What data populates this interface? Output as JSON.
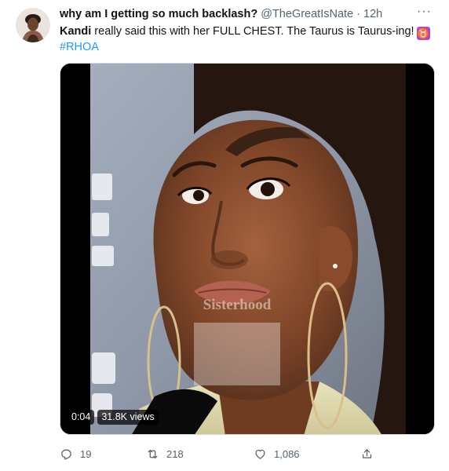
{
  "tweet": {
    "display_name": "why am I getting so much backlash?",
    "handle": "@TheGreatIsNate",
    "separator": "·",
    "time": "12h",
    "more": "···",
    "text": {
      "mention": "Kandi",
      "body": " really said this with her FULL CHEST. The Taurus is Taurus-ing!",
      "emoji": "♉",
      "hashtag": "#RHOA"
    },
    "media": {
      "watermark": "Sisterhood",
      "video_time": "0:04",
      "views": "31.8K views"
    },
    "actions": {
      "reply_count": "19",
      "retweet_count": "218",
      "like_count": "1,086"
    }
  },
  "colors": {
    "link": "#1d9bf0",
    "muted": "#536471",
    "text": "#0f1419",
    "taurus_emoji_bg": "#a84cd8"
  }
}
